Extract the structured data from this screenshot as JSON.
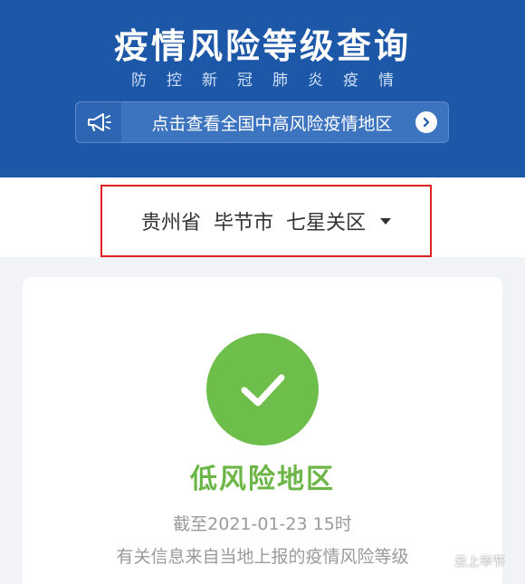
{
  "header": {
    "title": "疫情风险等级查询",
    "subtitle": "防控新冠肺炎疫情",
    "notice_text": "点击查看全国中高风险疫情地区",
    "notice_icon": "megaphone-icon",
    "arrow_icon": "chevron-right-icon"
  },
  "location": {
    "province": "贵州省",
    "city": "毕节市",
    "district": "七星关区",
    "dropdown_icon": "caret-down-icon"
  },
  "result": {
    "status_icon": "check-icon",
    "risk_level": "低风险地区",
    "as_of": "截至2021-01-23 15时",
    "source_note": "有关信息来自当地上报的疫情风险等级"
  },
  "watermark": {
    "text": "云上毕节"
  },
  "colors": {
    "header_bg": "#1c57a8",
    "low_risk_green": "#6dbe4a",
    "highlight_border": "#e02020"
  }
}
